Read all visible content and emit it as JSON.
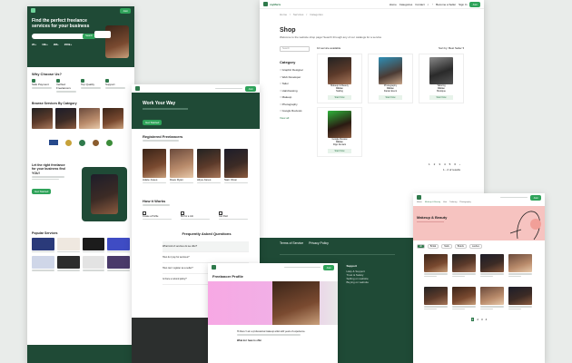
{
  "card_landing": {
    "hero_title": "Find the perfect freelance services for your business",
    "search_button": "Search",
    "stats": [
      "20+",
      "10k+",
      "2M+",
      "200k+"
    ],
    "why_title": "Why Choose Us?",
    "features": [
      "Safe Payment",
      "Verified Freelancers",
      "Top Quality",
      "Support"
    ],
    "browse_title": "Browse Services By Category",
    "cta_title": "Let the right freelance for your business find YOU!",
    "popular_title": "Popular Services"
  },
  "card_shop": {
    "nav": [
      "Home",
      "Categories",
      "Contact"
    ],
    "become_seller": "Become a Seller",
    "sign_in": "Sign In",
    "join": "Join",
    "breadcrumb": [
      "Home",
      "Services",
      "Categories"
    ],
    "title": "Shop",
    "subtitle": "Welcome to the website shop page! Search through any of our catalogs for a service",
    "search_placeholder": "Search",
    "results": "10 service available",
    "sort_label": "Sort by:",
    "sort_value": "Best Seller",
    "category_title": "Category",
    "categories": [
      "Graphic Designer",
      "Web Developer",
      "Tailor",
      "Hairdressing",
      "Makeup",
      "Photography",
      "Google Reviews"
    ],
    "view_all": "View all",
    "products": [
      {
        "top": "Makeup & Beauty",
        "name": "Eloise",
        "service": "Nailing",
        "btn": "Start Now"
      },
      {
        "top": "Photography",
        "name": "Eloise",
        "service": "Daniel Event",
        "btn": "Start Now"
      },
      {
        "top": "Tailoring",
        "name": "Eloise",
        "service": "Boutique",
        "btn": "Start Now"
      },
      {
        "top": "Google Review",
        "name": "Eloise",
        "service": "Digo Deniels",
        "btn": "Start Now"
      }
    ],
    "pages": [
      "1",
      "2",
      "3",
      "4",
      "5",
      "6"
    ],
    "showing": "1 - 2 of results"
  },
  "card_work": {
    "hero_title": "Work Your Way",
    "hero_btn": "Get Started",
    "registered_title": "Registered Freelancers",
    "freelancers": [
      {
        "name": "Adele Joses",
        "role": "Photographer"
      },
      {
        "name": "Dave Ryan",
        "role": "Web Developer"
      },
      {
        "name": "Aliya Jones",
        "role": "Designer"
      },
      {
        "name": "Sam Okon",
        "role": "Tailor"
      }
    ],
    "how_title": "How it Works",
    "steps": [
      "Create a Profile",
      "Bid for a Job",
      "Get Paid"
    ],
    "faq_title": "Frequently Asked Questions",
    "faqs": [
      "What kind of services do we offer?",
      "How do I pay for services?",
      "How can I register as a seller?",
      "Is there a refund policy?",
      "Can I hire from anywhere?",
      "What are the fees?"
    ]
  },
  "card_footer": {
    "links": [
      "Terms of Service",
      "Privacy Policy"
    ],
    "cols": [
      {
        "title": "About",
        "items": [
          "About us",
          "Careers",
          "Press",
          "Partners"
        ]
      },
      {
        "title": "Categories",
        "items": [
          "Design",
          "Development",
          "Writing",
          "Marketing"
        ]
      },
      {
        "title": "Support",
        "items": [
          "Help & Support",
          "Trust & Safety",
          "Selling on website",
          "Buying on website"
        ]
      }
    ]
  },
  "card_profile": {
    "breadcrumb": [
      "Home",
      "Page",
      "Freelancer Profile"
    ],
    "title": "Freelancer Profile",
    "desc": "Hi there! I am a professional makeup artist with years of experience.",
    "sub": "What do I have to offer"
  },
  "card_makeup": {
    "banner_title": "Makeup & Beauty",
    "nav": [
      "Home",
      "Makeup & Beauty",
      "Hair",
      "Tailoring",
      "Photography",
      "Digital",
      "Services"
    ],
    "filters": [
      "All",
      "Bridal",
      "Nails",
      "Braids",
      "Lashes"
    ],
    "pages": [
      "1",
      "2",
      "3",
      "4"
    ]
  },
  "colors": {
    "brand": "#2f7a4c",
    "dark": "#1f4a36",
    "accent": "#2fa35a",
    "pink": "#f6c3c0"
  }
}
